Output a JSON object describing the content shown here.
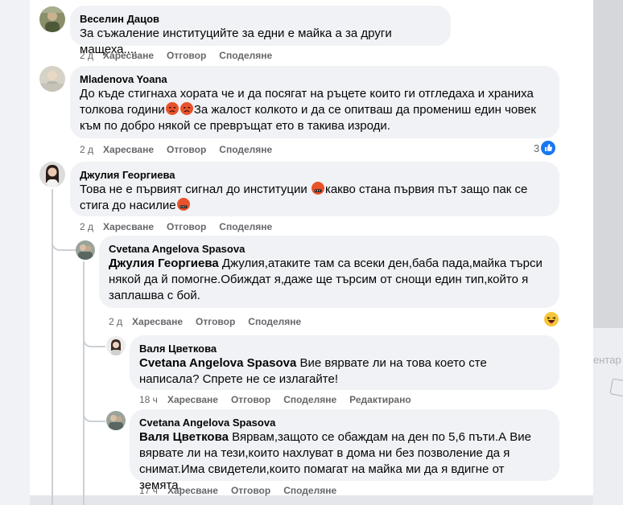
{
  "comments": [
    {
      "author": "Веселин Дацов",
      "text": "За съжаление институцийте за едни е майка а за други мащеха....",
      "time": "2 д",
      "like": "Харесване",
      "reply": "Отговор",
      "share": "Споделяне"
    },
    {
      "author": "Mladenova Yoana",
      "text_a": "До къде стигнаха хората че и да посягат на ръцете които ги отгледаха и храниха толкова години",
      "text_b": "За жалост колкото и да се опитваш да промениш един човек към по добро някой се превръщат ето в такива изроди.",
      "time": "2 д",
      "like": "Харесване",
      "reply": "Отговор",
      "share": "Споделяне",
      "reaction_count": "3",
      "reaction_icon": "like-icon"
    },
    {
      "author": "Джулия Георгиева",
      "text_a": "Това не е първият сигнал до институции",
      "text_b": "какво стана първия път защо пак се стига до насилие",
      "time": "2 д",
      "like": "Харесване",
      "reply": "Отговор",
      "share": "Споделяне"
    }
  ],
  "replies": [
    {
      "author": "Cvetana Angelova Spasova",
      "mention": "Джулия Георгиева",
      "text": "Джулия,атаките там са всеки ден,баба пада,майка търси някой да й помогне.Обиждат я,даже ще търсим от снощи един тип,който я заплашва с бой.",
      "time": "2 д",
      "like": "Харесване",
      "reply": "Отговор",
      "share": "Споделяне",
      "reaction_icon": "haha-icon"
    },
    {
      "author": "Валя Цветкова",
      "mention": "Cvetana Angelova Spasova",
      "text": "Вие вярвате ли на това което сте написала? Спрете не се излагайте!",
      "time": "18 ч",
      "like": "Харесване",
      "reply": "Отговор",
      "share": "Споделяне",
      "edited": "Редактирано"
    },
    {
      "author": "Cvetana Angelova Spasova",
      "mention": "Валя Цветкова",
      "text": "Вярвам,защото се обаждам на ден по 5,6 пъти.А Вие вярвате ли на тези,които нахлуват в дома ни без позволение да я снимат.Има свидетели,които помагат на майка ми да я вдигне от земята.",
      "time": "17 ч",
      "like": "Харесване",
      "reply": "Отговор",
      "share": "Споделяне"
    }
  ],
  "background": {
    "ghost_text": "ентар"
  },
  "colors": {
    "bubble": "#f0f2f5",
    "meta": "#65676b",
    "like_blue": "#1877f2"
  }
}
